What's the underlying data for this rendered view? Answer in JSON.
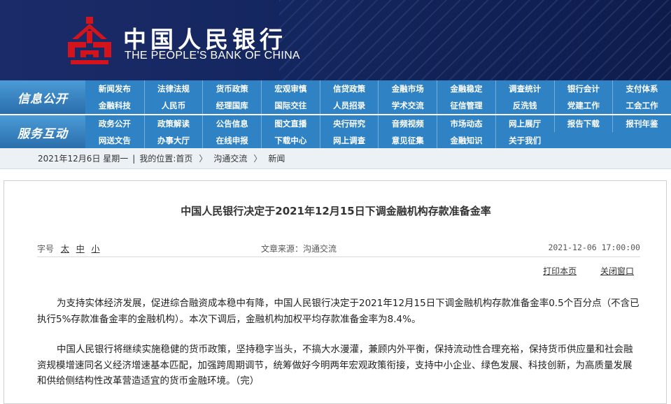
{
  "header": {
    "logo_cn": "中国人民银行",
    "logo_en": "THE PEOPLE'S BANK OF CHINA"
  },
  "nav": {
    "section1_label": "信息公开",
    "section2_label": "服务互动",
    "row1": [
      "新闻发布",
      "法律法规",
      "货币政策",
      "宏观审慎",
      "信贷政策",
      "金融市场",
      "金融稳定",
      "调查统计",
      "银行会计",
      "支付体系"
    ],
    "row2": [
      "金融科技",
      "人民币",
      "经理国库",
      "国际交往",
      "人员招录",
      "学术交流",
      "征信管理",
      "反洗钱",
      "党建工作",
      "工会工作"
    ],
    "row3": [
      "政务公开",
      "政策解读",
      "公告信息",
      "图文直播",
      "央行研究",
      "音频视频",
      "市场动态",
      "网上展厅",
      "报告下载",
      "报刊年鉴"
    ],
    "row4": [
      "网送文告",
      "办事大厅",
      "在线申报",
      "下载中心",
      "网上调查",
      "意见征集",
      "金融知识",
      "关于我们"
    ]
  },
  "breadcrumb": {
    "date": "2021年12月6日 星期一",
    "location_prefix": "我的位置:",
    "home": "首页",
    "arrow": "〉",
    "level1": "沟通交流",
    "level2": "新闻"
  },
  "article": {
    "title": "中国人民银行决定于2021年12月15日下调金融机构存款准备金率",
    "size_label": "字号",
    "size_large": "太",
    "size_medium": "中",
    "size_small": "小",
    "source": "文章来源：沟通交流",
    "datetime": "2021-12-06 17:00:00",
    "print_label": "打印本页",
    "close_label": "关闭窗口",
    "paragraph1": "为支持实体经济发展，促进综合融资成本稳中有降，中国人民银行决定于2021年12月15日下调金融机构存款准备金率0.5个百分点（不含已执行5%存款准备金率的金融机构）。本次下调后，金融机构加权平均存款准备金率为8.4%。",
    "paragraph2": "中国人民银行将继续实施稳健的货币政策，坚持稳字当头，不搞大水漫灌，兼顾内外平衡，保持流动性合理充裕，保持货币供应量和社会融资规模增速同名义经济增速基本匹配，加强跨周期调节，统筹做好今明两年宏观政策衔接，支持中小企业、绿色发展、科技创新，为高质量发展和供给侧结构性改革营造适宜的货币金融环境。（完）"
  },
  "colors": {
    "header_bg": "#13235a",
    "nav_bg": "#2f83c4",
    "logo_red": "#d4141c"
  }
}
